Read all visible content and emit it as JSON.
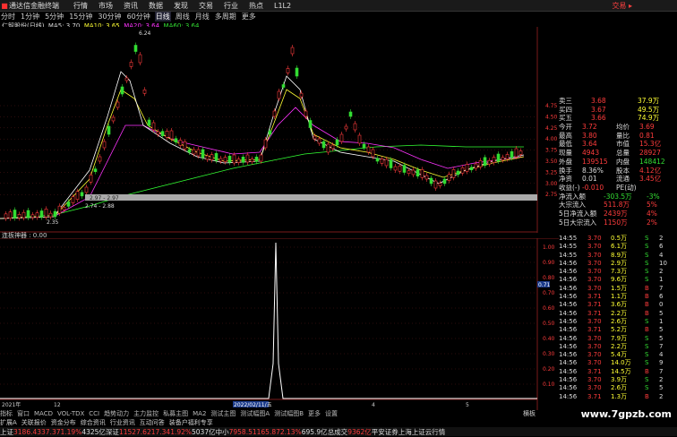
{
  "menubar": {
    "app_title": "通达信金融终端",
    "items": [
      "行情",
      "市场",
      "资讯",
      "数据",
      "发现",
      "交易",
      "行业",
      "热点",
      "L1L2"
    ],
    "right_label": "交易 ▸"
  },
  "periods": [
    "分时",
    "1分钟",
    "5分钟",
    "15分钟",
    "30分钟",
    "60分钟",
    "日线",
    "周线",
    "月线",
    "多周期",
    "更多"
  ],
  "selected_period": "日线",
  "indicator_line": {
    "name": "仁智股份(日线)",
    "ma5": "MA5: 3.70",
    "ma10": "MA10: 3.65",
    "ma20": "MA20: 3.64",
    "ma60": "MA60: 3.64"
  },
  "price_axis": [
    "4.75",
    "4.50",
    "4.25",
    "4.00",
    "3.75",
    "3.50",
    "3.25",
    "3.00",
    "2.75"
  ],
  "chart_annotations": {
    "high": "6.24",
    "low1": "2.35",
    "low2": "2.74 - 2.88",
    "band": "2.97 - 2.97"
  },
  "sub_indicator": {
    "label": "连板神器 : 0.00",
    "axis": [
      "1.00",
      "0.90",
      "0.80",
      "0.70",
      "0.60",
      "0.50",
      "0.40",
      "0.30",
      "0.20",
      "0.10"
    ],
    "marker": "0.71"
  },
  "date_axis": [
    "2021年",
    "12",
    "2022/02/11/五",
    "4",
    "5"
  ],
  "quote": {
    "rows": [
      {
        "label": "卖三",
        "price": "3.68",
        "vol": "37.9万",
        "pc": "green"
      },
      {
        "label": "买四",
        "price": "3.67",
        "vol": "49.5万",
        "pc": "wht"
      },
      {
        "label": "买五",
        "price": "3.66",
        "vol": "74.9万",
        "pc": "green"
      },
      {
        "label": "今开",
        "price": "3.72",
        "k2": "均价",
        "v2": "3.69"
      },
      {
        "label": "最高",
        "price": "3.80",
        "k2": "量比",
        "v2": "0.81"
      },
      {
        "label": "最低",
        "price": "3.64",
        "k2": "市值",
        "v2": "15.3亿"
      },
      {
        "label": "现量",
        "price": "4943",
        "k2": "总量",
        "v2": "28927"
      },
      {
        "label": "外盘",
        "price": "139515",
        "k2": "内盘",
        "v2": "148412"
      },
      {
        "label": "换手",
        "price": "8.36%",
        "k2": "股本",
        "v2": "4.12亿"
      },
      {
        "label": "净资",
        "price": "0.01",
        "k2": "流通",
        "v2": "3.45亿"
      },
      {
        "label": "收益(-)",
        "price": "-0.010",
        "k2": "PE(动)",
        "v2": ""
      }
    ],
    "flows": [
      {
        "label": "净流入额",
        "value": "-303.5万",
        "pct": "-3%"
      },
      {
        "label": "大宗流入",
        "value": "511.8万",
        "pct": "5%"
      },
      {
        "label": "5日净流入额",
        "value": "2439万",
        "pct": "4%"
      },
      {
        "label": "5日大宗流入",
        "value": "1150万",
        "pct": "2%"
      }
    ]
  },
  "ticks": [
    [
      "14:55",
      "3.70",
      "0.5万",
      "S",
      "2"
    ],
    [
      "14:55",
      "3.70",
      "6.1万",
      "S",
      "6"
    ],
    [
      "14:55",
      "3.70",
      "8.9万",
      "S",
      "4"
    ],
    [
      "14:56",
      "3.70",
      "2.9万",
      "S",
      "10"
    ],
    [
      "14:56",
      "3.70",
      "7.3万",
      "S",
      "2"
    ],
    [
      "14:56",
      "3.70",
      "9.6万",
      "S",
      "1"
    ],
    [
      "14:56",
      "3.70",
      "1.5万",
      "B",
      "7"
    ],
    [
      "14:56",
      "3.71",
      "1.1万",
      "B",
      "6"
    ],
    [
      "14:56",
      "3.71",
      "3.6万",
      "B",
      "0"
    ],
    [
      "14:56",
      "3.71",
      "2.2万",
      "B",
      "5"
    ],
    [
      "14:56",
      "3.70",
      "2.6万",
      "S",
      "1"
    ],
    [
      "14:56",
      "3.71",
      "5.2万",
      "B",
      "5"
    ],
    [
      "14:56",
      "3.70",
      "7.9万",
      "S",
      "5"
    ],
    [
      "14:56",
      "3.70",
      "2.2万",
      "S",
      "7"
    ],
    [
      "14:56",
      "3.70",
      "5.4万",
      "S",
      "4"
    ],
    [
      "14:56",
      "3.70",
      "14.0万",
      "S",
      "9"
    ],
    [
      "14:56",
      "3.71",
      "14.5万",
      "B",
      "7"
    ],
    [
      "14:56",
      "3.70",
      "3.9万",
      "S",
      "2"
    ],
    [
      "14:56",
      "3.70",
      "2.6万",
      "S",
      "5"
    ],
    [
      "14:56",
      "3.71",
      "1.3万",
      "B",
      "2"
    ]
  ],
  "tabbar": [
    "指标",
    "窗口",
    "MACD",
    "VOL-TDX",
    "CCI",
    "趋势动力",
    "主力监控",
    "私募主图",
    "MA2",
    "测试主图",
    "测试幅图A",
    "测试幅图B",
    "更多",
    "设置"
  ],
  "funcbar": [
    "扩展A",
    "关联报价",
    "资金分布",
    "综合资讯",
    "行业资讯",
    "互动问答",
    "装备户福利专享"
  ],
  "status": [
    {
      "k": "上证",
      "v": "3186.43",
      "d": "37.37",
      "p": "1.19%",
      "amt": "4325亿"
    },
    {
      "k": "深证",
      "v": "11527.6",
      "d": "217.34",
      "p": "1.92%",
      "amt": "5037亿"
    },
    {
      "k": "中小",
      "v": "7958.51",
      "d": "165.87",
      "p": "2.13%",
      "amt": "695.9亿"
    },
    {
      "k": "总成交",
      "v": "9362亿",
      "d": "",
      "p": "",
      "amt": ""
    }
  ],
  "status_right": "平安证券上海上证云行情",
  "right_tag": "横板",
  "watermark": "www.7gpzb.com",
  "colors": {
    "up": "#ff3c3c",
    "down": "#33dd33",
    "ma5": "#ffffff",
    "ma10": "#ffff33",
    "ma20": "#ff33ff",
    "ma60": "#33ff33"
  }
}
